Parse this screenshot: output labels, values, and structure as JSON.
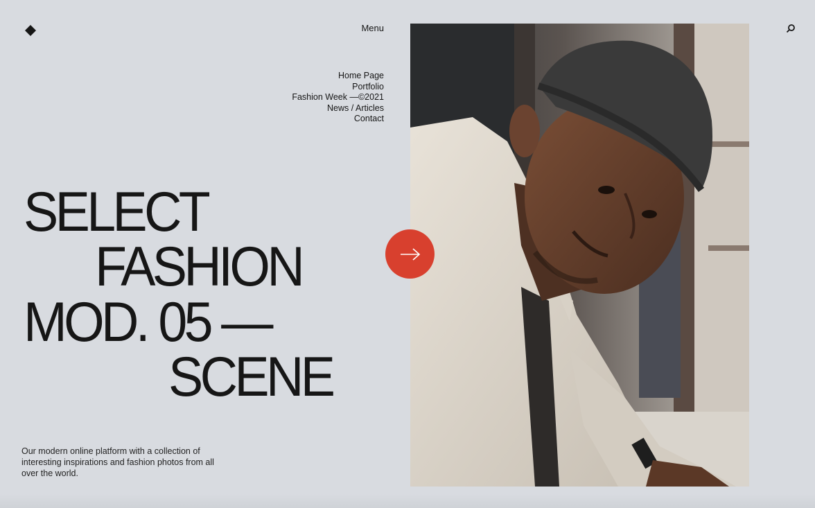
{
  "header": {
    "logo_icon": "diamond-icon",
    "menu_label": "Menu",
    "search_icon": "search-icon"
  },
  "nav": {
    "items": [
      {
        "label": "Home Page"
      },
      {
        "label": "Portfolio"
      },
      {
        "label": "Fashion Week —©2021"
      },
      {
        "label": "News / Articles"
      },
      {
        "label": "Contact"
      }
    ]
  },
  "hero": {
    "line1": "SELECT",
    "line2": "FASHION",
    "line3": "MOD. 05 —",
    "line4": "SCENE",
    "description": "Our modern online platform with a collection of interesting inspirations and fashion photos from all over the world.",
    "next_icon": "arrow-right-icon"
  },
  "colors": {
    "background": "#d8dbe0",
    "text": "#161616",
    "accent": "#d8402e"
  }
}
